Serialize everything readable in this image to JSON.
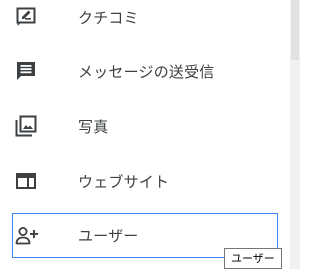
{
  "menu": {
    "items": [
      {
        "icon": "review-icon",
        "label": "クチコミ"
      },
      {
        "icon": "message-icon",
        "label": "メッセージの送受信"
      },
      {
        "icon": "photo-icon",
        "label": "写真"
      },
      {
        "icon": "website-icon",
        "label": "ウェブサイト"
      },
      {
        "icon": "add-user-icon",
        "label": "ユーザー"
      }
    ],
    "focused_index": 4
  },
  "tooltip": {
    "text": "ユーザー"
  },
  "colors": {
    "icon": "#3c4043",
    "label": "#3c4043",
    "focus_border": "#4285f4"
  }
}
